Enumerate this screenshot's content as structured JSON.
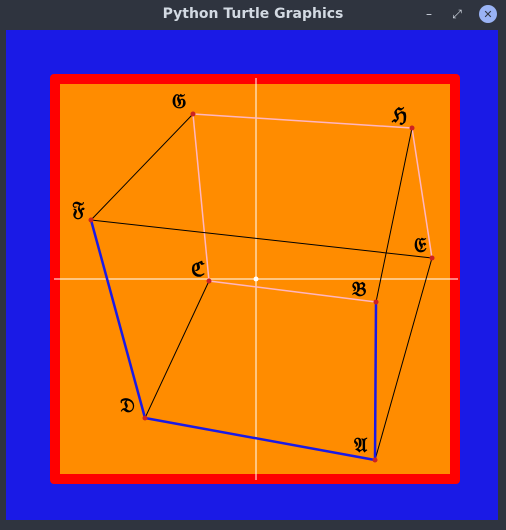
{
  "window": {
    "title": "Python Turtle Graphics",
    "minimize_glyph": "–",
    "maximize_glyph": "⤢",
    "close_glyph": "✕"
  },
  "colors": {
    "background": "#1a1ae6",
    "border": "#ff0000",
    "field": "#ff8c00",
    "axes": "#ffffff",
    "front_edges": "#1a1ae6",
    "back_edges": "#ffb6c1",
    "dark_edges": "#000000",
    "vertex": "#cc2222"
  },
  "vertices": [
    {
      "id": "A",
      "label": "𝔄"
    },
    {
      "id": "B",
      "label": "𝔅"
    },
    {
      "id": "C",
      "label": "ℭ"
    },
    {
      "id": "D",
      "label": "𝔇"
    },
    {
      "id": "E",
      "label": "𝔈"
    },
    {
      "id": "F",
      "label": "𝔉"
    },
    {
      "id": "G",
      "label": "𝔊"
    },
    {
      "id": "H",
      "label": "ℌ"
    }
  ]
}
